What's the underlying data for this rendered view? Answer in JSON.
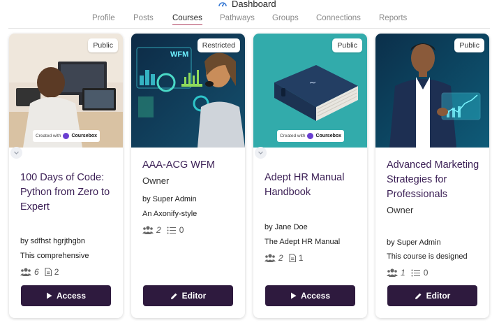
{
  "header": {
    "title": "Dashboard"
  },
  "tabs": [
    {
      "label": "Profile",
      "active": false
    },
    {
      "label": "Posts",
      "active": false
    },
    {
      "label": "Courses",
      "active": true
    },
    {
      "label": "Pathways",
      "active": false
    },
    {
      "label": "Groups",
      "active": false
    },
    {
      "label": "Connections",
      "active": false
    },
    {
      "label": "Reports",
      "active": false
    }
  ],
  "colors": {
    "accent": "#2e1a3e",
    "title": "#3b1f55",
    "tab_underline": "#b0415f"
  },
  "watermark": {
    "prefix": "Created with",
    "brand": "Coursebox"
  },
  "cards": [
    {
      "badge": "Public",
      "title": "100 Days of Code: Python from Zero to Expert",
      "role": "",
      "author": "by sdfhst hgrjthgbn",
      "description": "This comprehensive",
      "members": "6",
      "lessons": "2",
      "button": "Access",
      "button_icon": "play-icon"
    },
    {
      "badge": "Restricted",
      "title": "AAA-ACG WFM",
      "role": "Owner",
      "author": "by Super Admin",
      "description": "An Axonify-style",
      "members": "2",
      "lessons": "0",
      "button": "Editor",
      "button_icon": "pencil-icon",
      "image_text": "WFM"
    },
    {
      "badge": "Public",
      "title": "Adept HR Manual Handbook",
      "role": "",
      "author": "by Jane Doe",
      "description": "The Adept HR Manual",
      "members": "2",
      "lessons": "1",
      "button": "Access",
      "button_icon": "play-icon"
    },
    {
      "badge": "Public",
      "title": "Advanced Marketing Strategies for Professionals",
      "role": "Owner",
      "author": "by Super Admin",
      "description": "This course is designed",
      "members": "1",
      "lessons": "0",
      "button": "Editor",
      "button_icon": "pencil-icon"
    }
  ]
}
